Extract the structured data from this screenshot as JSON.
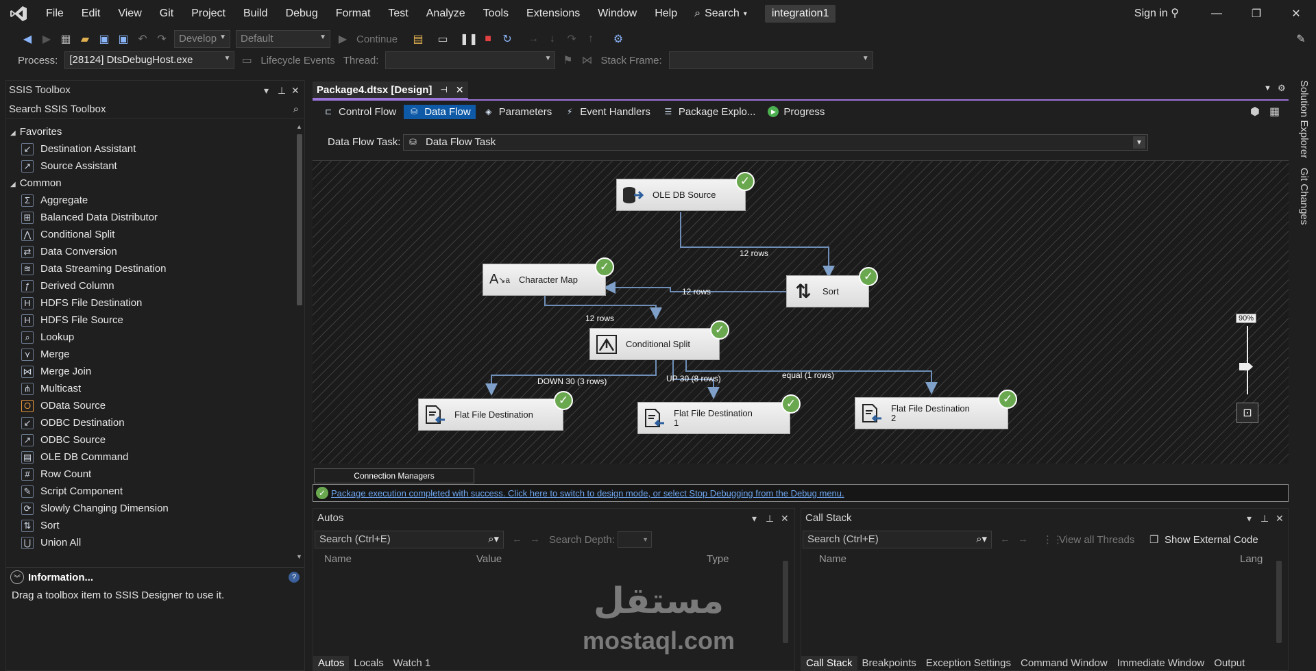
{
  "menubar": {
    "items": [
      "File",
      "Edit",
      "View",
      "Git",
      "Project",
      "Build",
      "Debug",
      "Format",
      "Test",
      "Analyze",
      "Tools",
      "Extensions",
      "Window",
      "Help"
    ],
    "search_label": "Search",
    "solution_name": "integration1",
    "signin_label": "Sign in"
  },
  "toolbar1": {
    "config_combo": "Develop",
    "platform_combo": "Default",
    "continue_label": "Continue"
  },
  "toolbar2": {
    "process_label": "Process:",
    "process_value": "[28124] DtsDebugHost.exe",
    "lifecycle_label": "Lifecycle Events",
    "thread_label": "Thread:",
    "stackframe_label": "Stack Frame:"
  },
  "toolbox": {
    "title": "SSIS Toolbox",
    "search_placeholder": "Search SSIS Toolbox",
    "groups": [
      {
        "name": "Favorites",
        "items": [
          "Destination Assistant",
          "Source Assistant"
        ]
      },
      {
        "name": "Common",
        "items": [
          "Aggregate",
          "Balanced Data Distributor",
          "Conditional Split",
          "Data Conversion",
          "Data Streaming Destination",
          "Derived Column",
          "HDFS File Destination",
          "HDFS File Source",
          "Lookup",
          "Merge",
          "Merge Join",
          "Multicast",
          "OData Source",
          "ODBC Destination",
          "ODBC Source",
          "OLE DB Command",
          "Row Count",
          "Script Component",
          "Slowly Changing Dimension",
          "Sort",
          "Union All"
        ]
      }
    ],
    "info_title": "Information...",
    "info_text": "Drag a toolbox item to SSIS Designer to use it."
  },
  "document": {
    "tab_title": "Package4.dtsx [Design]",
    "designer_tabs": [
      "Control Flow",
      "Data Flow",
      "Parameters",
      "Event Handlers",
      "Package Explo...",
      "Progress"
    ],
    "active_tab": "Data Flow",
    "dft_label": "Data Flow Task:",
    "dft_value": "Data Flow Task",
    "zoom": "90%",
    "connection_managers_label": "Connection Managers",
    "status_message": "Package execution completed with success. Click here to switch to design mode, or select Stop Debugging from the Debug menu."
  },
  "flow": {
    "components": [
      {
        "id": "ole",
        "label": "OLE DB Source"
      },
      {
        "id": "sort",
        "label": "Sort"
      },
      {
        "id": "charmap",
        "label": "Character Map"
      },
      {
        "id": "split",
        "label": "Conditional Split"
      },
      {
        "id": "ffd",
        "label": "Flat File Destination"
      },
      {
        "id": "ffd1",
        "label": "Flat File Destination",
        "label2": "1"
      },
      {
        "id": "ffd2",
        "label": "Flat File Destination",
        "label2": "2"
      }
    ],
    "paths": [
      {
        "from": "ole",
        "to": "sort",
        "label": "12 rows"
      },
      {
        "from": "sort",
        "to": "charmap",
        "label": "12 rows"
      },
      {
        "from": "charmap",
        "to": "split",
        "label": "12 rows"
      },
      {
        "from": "split",
        "to": "ffd",
        "label": "DOWN 30 (3 rows)"
      },
      {
        "from": "split",
        "to": "ffd1",
        "label": "UP 30 (8 rows)"
      },
      {
        "from": "split",
        "to": "ffd2",
        "label": "equal (1 rows)"
      }
    ]
  },
  "right_rail": {
    "tabs": [
      "Solution Explorer",
      "Git Changes"
    ]
  },
  "autos": {
    "title": "Autos",
    "search_placeholder": "Search (Ctrl+E)",
    "search_depth_label": "Search Depth:",
    "columns": [
      "Name",
      "Value",
      "Type"
    ],
    "tabs": [
      "Autos",
      "Locals",
      "Watch 1"
    ]
  },
  "callstack": {
    "title": "Call Stack",
    "search_placeholder": "Search (Ctrl+E)",
    "view_threads_label": "View all Threads",
    "show_external_label": "Show External Code",
    "columns": [
      "Name",
      "Lang"
    ],
    "tabs": [
      "Call Stack",
      "Breakpoints",
      "Exception Settings",
      "Command Window",
      "Immediate Window",
      "Output"
    ]
  },
  "watermark": {
    "arabic": "مستقل",
    "latin": "mostaql.com"
  }
}
